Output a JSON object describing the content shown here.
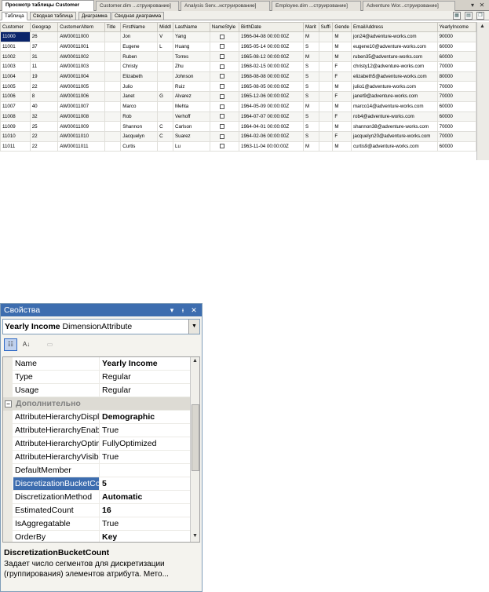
{
  "doc_tabs": [
    {
      "label": "Просмотр таблицы Customer",
      "active": true
    },
    {
      "label": "Customer.dim ...струирование]",
      "active": false
    },
    {
      "label": "Analysis Serv...нструирование]",
      "active": false
    },
    {
      "label": "Employee.dim ...струирование]",
      "active": false
    },
    {
      "label": "Adventure Wor...струирование]",
      "active": false
    }
  ],
  "window_buttons": {
    "dropdown": "▾",
    "close": "✕"
  },
  "sub_tabs": [
    {
      "label": "Таблица",
      "active": true
    },
    {
      "label": "Сводная таблица",
      "active": false
    },
    {
      "label": "Диаграмма",
      "active": false
    },
    {
      "label": "Сводная диаграмма",
      "active": false
    }
  ],
  "toolbar_icons": [
    "grid-icon",
    "save-icon",
    "copy-icon"
  ],
  "grid": {
    "columns": [
      "CustomerKey",
      "GeographyKey",
      "CustomerAlternateKey",
      "Title",
      "FirstName",
      "MiddleName",
      "LastName",
      "NameStyle",
      "BirthDate",
      "MaritalStatus",
      "Suffix",
      "Gender",
      "EmailAddress",
      "YearlyIncome"
    ],
    "column_headers": [
      "Customer",
      "Geograp",
      "CustomerAltern",
      "Title",
      "FirstName",
      "Middl",
      "LastName",
      "NameStyle",
      "BirthDate",
      "Marit",
      "Suffi",
      "Gende",
      "EmailAddress",
      "YearlyIncome"
    ],
    "rows": [
      [
        "11000",
        "26",
        "AW00011000",
        "",
        "Jon",
        "V",
        "Yang",
        "",
        "1966-04-08 00:00:00Z",
        "M",
        "",
        "M",
        "jon24@adventure-works.com",
        "90000"
      ],
      [
        "11001",
        "37",
        "AW00011001",
        "",
        "Eugene",
        "L",
        "Huang",
        "",
        "1965-05-14 00:00:00Z",
        "S",
        "",
        "M",
        "eugene10@adventure-works.com",
        "60000"
      ],
      [
        "11002",
        "31",
        "AW00011002",
        "",
        "Ruben",
        "",
        "Torres",
        "",
        "1965-08-12 00:00:00Z",
        "M",
        "",
        "M",
        "ruben35@adventure-works.com",
        "60000"
      ],
      [
        "11003",
        "11",
        "AW00011003",
        "",
        "Christy",
        "",
        "Zhu",
        "",
        "1968-02-15 00:00:00Z",
        "S",
        "",
        "F",
        "christy12@adventure-works.com",
        "70000"
      ],
      [
        "11004",
        "19",
        "AW00011004",
        "",
        "Elizabeth",
        "",
        "Johnson",
        "",
        "1968-08-08 00:00:00Z",
        "S",
        "",
        "F",
        "elizabeth5@adventure-works.com",
        "80000"
      ],
      [
        "11005",
        "22",
        "AW00011005",
        "",
        "Julio",
        "",
        "Ruiz",
        "",
        "1965-08-05 00:00:00Z",
        "S",
        "",
        "M",
        "julio1@adventure-works.com",
        "70000"
      ],
      [
        "11006",
        "8",
        "AW00011006",
        "",
        "Janet",
        "G",
        "Alvarez",
        "",
        "1965-12-06 00:00:00Z",
        "S",
        "",
        "F",
        "janet9@adventure-works.com",
        "70000"
      ],
      [
        "11007",
        "40",
        "AW00011007",
        "",
        "Marco",
        "",
        "Mehta",
        "",
        "1964-05-09 00:00:00Z",
        "M",
        "",
        "M",
        "marco14@adventure-works.com",
        "60000"
      ],
      [
        "11008",
        "32",
        "AW00011008",
        "",
        "Rob",
        "",
        "Verhoff",
        "",
        "1964-07-07 00:00:00Z",
        "S",
        "",
        "F",
        "rob4@adventure-works.com",
        "60000"
      ],
      [
        "11009",
        "25",
        "AW00011009",
        "",
        "Shannon",
        "C",
        "Carlson",
        "",
        "1964-04-01 00:00:00Z",
        "S",
        "",
        "M",
        "shannon38@adventure-works.com",
        "70000"
      ],
      [
        "11010",
        "22",
        "AW00011010",
        "",
        "Jacquelyn",
        "C",
        "Suarez",
        "",
        "1964-02-06 00:00:00Z",
        "S",
        "",
        "F",
        "jacquelyn20@adventure-works.com",
        "70000"
      ],
      [
        "11011",
        "22",
        "AW00011011",
        "",
        "Curtis",
        "",
        "Lu",
        "",
        "1963-11-04 00:00:00Z",
        "M",
        "",
        "M",
        "curtis9@adventure-works.com",
        "60000"
      ]
    ],
    "selected_cell": {
      "row": 0,
      "col": 0
    }
  },
  "properties": {
    "title": "Свойства",
    "title_buttons": {
      "dropdown": "▾",
      "pin": "ᵻ",
      "close": "✕"
    },
    "object_name": "Yearly Income",
    "object_type": "DimensionAttribute",
    "rows": [
      {
        "name": "Name",
        "value": "Yearly Income",
        "bold": true
      },
      {
        "name": "Type",
        "value": "Regular",
        "bold": false
      },
      {
        "name": "Usage",
        "value": "Regular",
        "bold": false
      },
      {
        "category": "Дополнительно"
      },
      {
        "name": "AttributeHierarchyDisplayFolder",
        "value": "Demographic",
        "bold": true
      },
      {
        "name": "AttributeHierarchyEnabled",
        "value": "True",
        "bold": false
      },
      {
        "name": "AttributeHierarchyOptimizedState",
        "value": "FullyOptimized",
        "bold": false
      },
      {
        "name": "AttributeHierarchyVisible",
        "value": "True",
        "bold": false
      },
      {
        "name": "DefaultMember",
        "value": "",
        "bold": false
      },
      {
        "name": "DiscretizationBucketCount",
        "value": "5",
        "bold": true,
        "selected": true
      },
      {
        "name": "DiscretizationMethod",
        "value": "Automatic",
        "bold": true
      },
      {
        "name": "EstimatedCount",
        "value": "16",
        "bold": true
      },
      {
        "name": "IsAggregatable",
        "value": "True",
        "bold": false
      },
      {
        "name": "OrderBy",
        "value": "Key",
        "bold": true
      }
    ],
    "description_title": "DiscretizationBucketCount",
    "description_text": "Задает число сегментов для дискретизации (группирования) элементов атрибута. Мето..."
  }
}
